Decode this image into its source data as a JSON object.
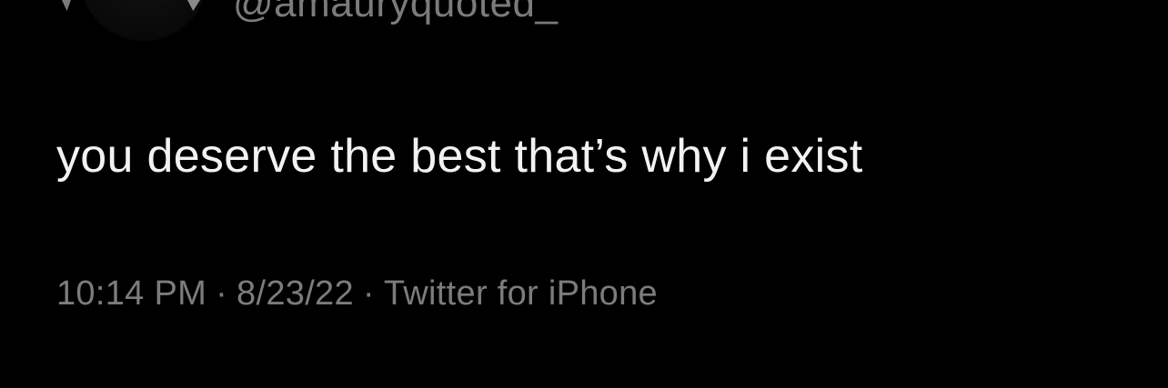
{
  "tweet": {
    "handle": "@amauryquoted_",
    "text": "you deserve the best that’s why i exist",
    "time": "10:14 PM",
    "date": "8/23/22",
    "source": "Twitter for iPhone",
    "separator": "·"
  },
  "colors": {
    "background": "#000000",
    "text": "#f2f2f2",
    "secondary_text": "#7c7c7c"
  }
}
